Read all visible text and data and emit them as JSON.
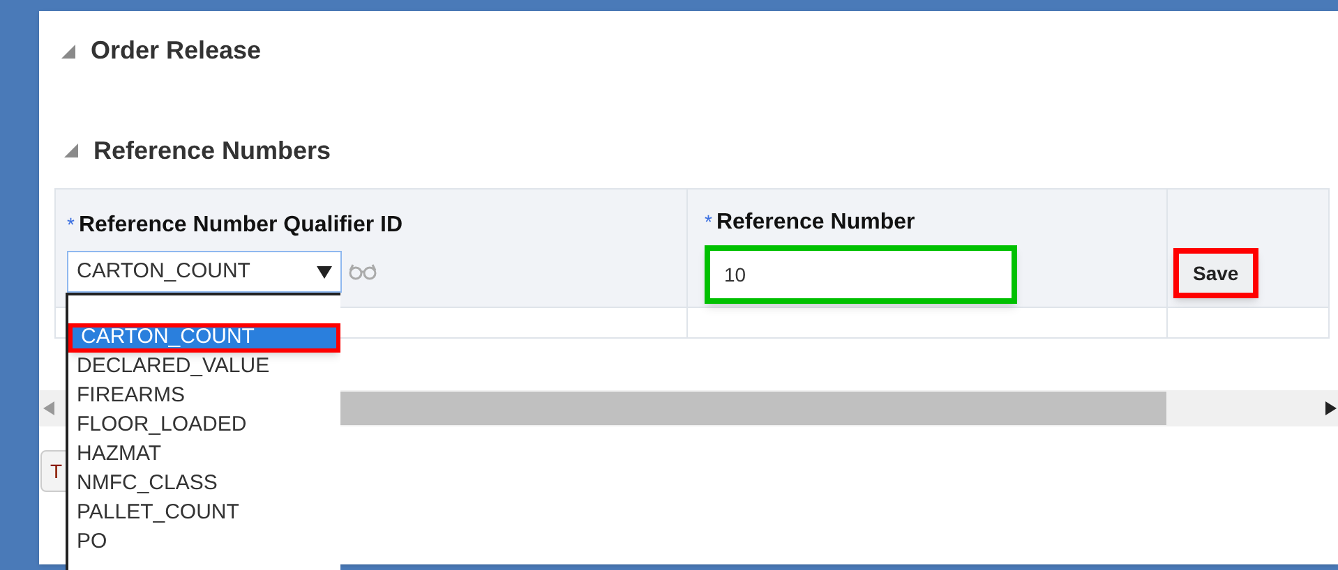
{
  "sections": [
    {
      "title": "Order Release",
      "expanded": true
    },
    {
      "title": "Reference Numbers",
      "expanded": true
    }
  ],
  "table": {
    "columns": [
      {
        "label": "Reference Number Qualifier ID",
        "required_mark": "*"
      },
      {
        "label": "Reference Number",
        "required_mark": "*"
      }
    ],
    "qualifier_select": {
      "value": "CARTON_COUNT",
      "expanded": true
    },
    "reference_field": {
      "value": "10",
      "highlighted": true
    },
    "save_button": {
      "label": "Save",
      "highlighted": true
    }
  },
  "partial_button": {
    "label": "T"
  },
  "dropdown_options": [
    {
      "label": "CARTON_COUNT",
      "selected": true,
      "highlighted": true
    },
    {
      "label": "DECLARED_VALUE",
      "selected": false
    },
    {
      "label": "FIREARMS",
      "selected": false
    },
    {
      "label": "FLOOR_LOADED",
      "selected": false
    },
    {
      "label": "HAZMAT",
      "selected": false
    },
    {
      "label": "NMFC_CLASS",
      "selected": false
    },
    {
      "label": "PALLET_COUNT",
      "selected": false
    },
    {
      "label": "PO",
      "selected": false
    }
  ]
}
